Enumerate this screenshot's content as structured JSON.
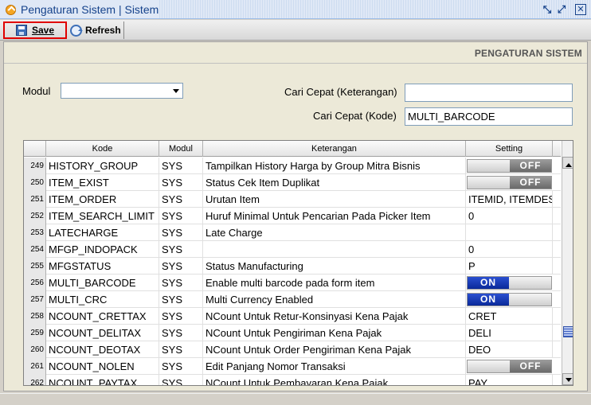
{
  "window": {
    "title": "Pengaturan Sistem | Sistem"
  },
  "toolbar": {
    "save_label": "Save",
    "refresh_label": "Refresh"
  },
  "section": {
    "title": "PENGATURAN SISTEM"
  },
  "filters": {
    "modul_label": "Modul",
    "modul_value": "",
    "keterangan_label": "Cari Cepat (Keterangan)",
    "keterangan_value": "",
    "kode_label": "Cari Cepat (Kode)",
    "kode_value": "MULTI_BARCODE"
  },
  "grid": {
    "columns": [
      "Kode",
      "Modul",
      "Keterangan",
      "Setting"
    ],
    "rows": [
      {
        "no": "249",
        "kode": "HISTORY_GROUP",
        "modul": "SYS",
        "keterangan": "Tampilkan History Harga by Group Mitra Bisnis",
        "setting": "OFF",
        "toggle": "off"
      },
      {
        "no": "250",
        "kode": "ITEM_EXIST",
        "modul": "SYS",
        "keterangan": "Status Cek Item Duplikat",
        "setting": "OFF",
        "toggle": "off"
      },
      {
        "no": "251",
        "kode": "ITEM_ORDER",
        "modul": "SYS",
        "keterangan": "Urutan Item",
        "setting": "ITEMID, ITEMDES",
        "toggle": ""
      },
      {
        "no": "252",
        "kode": "ITEM_SEARCH_LIMIT",
        "modul": "SYS",
        "keterangan": "Huruf Minimal Untuk Pencarian Pada Picker Item",
        "setting": "0",
        "toggle": ""
      },
      {
        "no": "253",
        "kode": "LATECHARGE",
        "modul": "SYS",
        "keterangan": "Late Charge",
        "setting": "",
        "toggle": ""
      },
      {
        "no": "254",
        "kode": "MFGP_INDOPACK",
        "modul": "SYS",
        "keterangan": "",
        "setting": "0",
        "toggle": ""
      },
      {
        "no": "255",
        "kode": "MFGSTATUS",
        "modul": "SYS",
        "keterangan": "Status Manufacturing",
        "setting": "P",
        "toggle": ""
      },
      {
        "no": "256",
        "kode": "MULTI_BARCODE",
        "modul": "SYS",
        "keterangan": "Enable multi barcode pada form item",
        "setting": "ON",
        "toggle": "on"
      },
      {
        "no": "257",
        "kode": "MULTI_CRC",
        "modul": "SYS",
        "keterangan": "Multi Currency Enabled",
        "setting": "ON",
        "toggle": "on"
      },
      {
        "no": "258",
        "kode": "NCOUNT_CRETTAX",
        "modul": "SYS",
        "keterangan": "NCount Untuk Retur-Konsinyasi Kena Pajak",
        "setting": "CRET",
        "toggle": ""
      },
      {
        "no": "259",
        "kode": "NCOUNT_DELITAX",
        "modul": "SYS",
        "keterangan": "NCount Untuk Pengiriman Kena Pajak",
        "setting": "DELI",
        "toggle": ""
      },
      {
        "no": "260",
        "kode": "NCOUNT_DEOTAX",
        "modul": "SYS",
        "keterangan": "NCount Untuk Order Pengiriman Kena Pajak",
        "setting": "DEO",
        "toggle": ""
      },
      {
        "no": "261",
        "kode": "NCOUNT_NOLEN",
        "modul": "SYS",
        "keterangan": "Edit Panjang Nomor Transaksi",
        "setting": "OFF",
        "toggle": "off"
      },
      {
        "no": "262",
        "kode": "NCOUNT_PAYTAX",
        "modul": "SYS",
        "keterangan": "NCount Untuk Pembayaran Kena Pajak",
        "setting": "PAY",
        "toggle": ""
      }
    ]
  }
}
